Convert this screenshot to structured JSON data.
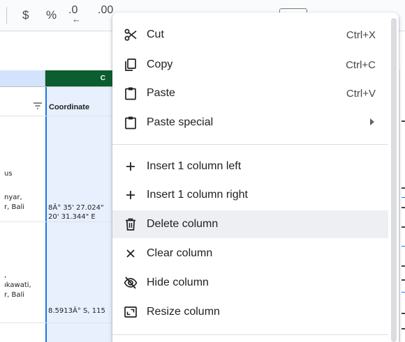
{
  "toolbar": {
    "currency_symbol": "$",
    "percent_symbol": "%",
    "decrease_decimal_label": ".0",
    "increase_decimal_label": ".00"
  },
  "columns": {
    "c_header": "C"
  },
  "sheet": {
    "col_c_title": "Coordinate",
    "b_row1_line1": "us",
    "b_row2_line1": "nyar,",
    "b_row2_line2": "r, Bali",
    "c_row2_line1": "8Â° 35' 27.024\"",
    "c_row2_line2": "20' 31.344\" E",
    "b_row3_line1": ",",
    "b_row3_line2": "ıkawati,",
    "b_row3_line3": "r, Bali",
    "c_row3_line1": "8.5913Â° S, 115"
  },
  "context_menu": {
    "items": [
      {
        "icon": "scissors-icon",
        "label": "Cut",
        "shortcut": "Ctrl+X"
      },
      {
        "icon": "copy-icon",
        "label": "Copy",
        "shortcut": "Ctrl+C"
      },
      {
        "icon": "clipboard-icon",
        "label": "Paste",
        "shortcut": "Ctrl+V"
      },
      {
        "icon": "clipboard-icon",
        "label": "Paste special",
        "shortcut": ""
      },
      {
        "icon": "plus-icon",
        "label": "Insert 1 column left",
        "shortcut": ""
      },
      {
        "icon": "plus-icon",
        "label": "Insert 1 column right",
        "shortcut": ""
      },
      {
        "icon": "trash-icon",
        "label": "Delete column",
        "shortcut": ""
      },
      {
        "icon": "close-icon",
        "label": "Clear column",
        "shortcut": ""
      },
      {
        "icon": "eye-off-icon",
        "label": "Hide column",
        "shortcut": ""
      },
      {
        "icon": "resize-icon",
        "label": "Resize column",
        "shortcut": ""
      }
    ],
    "highlighted_item": "Delete column"
  },
  "colors": {
    "selected_column_header": "#0b5e2f",
    "selected_column_fill": "#e8f0fe",
    "selection_border": "#1a73e8",
    "menu_hover": "#edeff2"
  }
}
